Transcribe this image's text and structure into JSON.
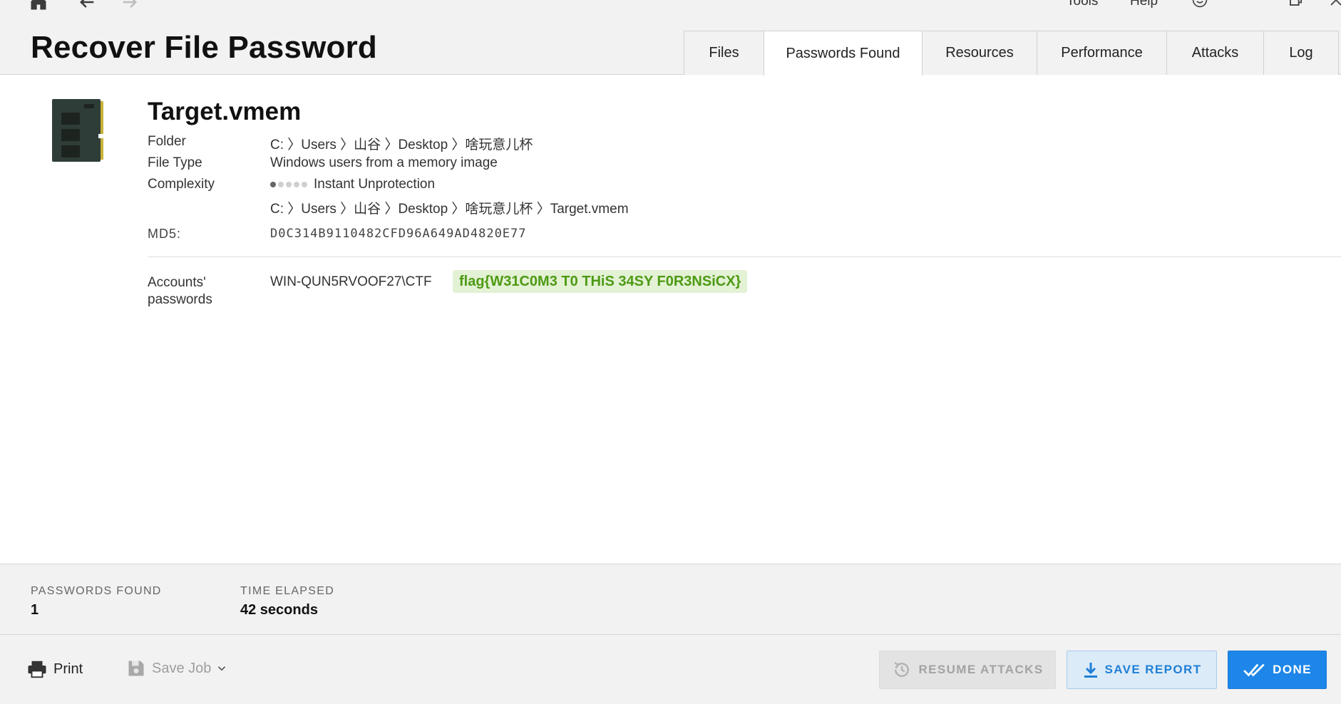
{
  "header": {
    "title": "Recover File Password",
    "menu": {
      "tools": "Tools",
      "help": "Help"
    },
    "tabs": [
      {
        "label": "Files"
      },
      {
        "label": "Passwords Found"
      },
      {
        "label": "Resources"
      },
      {
        "label": "Performance"
      },
      {
        "label": "Attacks"
      },
      {
        "label": "Log"
      }
    ],
    "active_tab": "Passwords Found"
  },
  "file": {
    "name": "Target.vmem",
    "icon": "memory-module-icon",
    "folder_label": "Folder",
    "folder_value": "C: 〉Users 〉山谷 〉Desktop 〉啥玩意儿杯",
    "type_label": "File Type",
    "type_value": "Windows users from a memory image",
    "complexity_label": "Complexity",
    "complexity_value": "Instant Unprotection",
    "complexity_level": 1,
    "complexity_max": 5,
    "full_path": "C: 〉Users 〉山谷 〉Desktop 〉啥玩意儿杯 〉Target.vmem",
    "md5_label": "MD5:",
    "md5_value": "D0C314B9110482CFD96A649AD4820E77",
    "accounts_label": "Accounts' passwords",
    "account_name": "WIN-QUN5RVOOF27\\CTF",
    "account_password": "flag{W31C0M3 T0 THiS 34SY F0R3NSiCX}"
  },
  "stats": {
    "passwords_found_label": "PASSWORDS FOUND",
    "passwords_found_value": "1",
    "time_elapsed_label": "TIME ELAPSED",
    "time_elapsed_value": "42 seconds"
  },
  "footer": {
    "print_label": "Print",
    "save_job_label": "Save Job",
    "resume_label": "RESUME ATTACKS",
    "save_report_label": "SAVE REPORT",
    "done_label": "DONE"
  },
  "colors": {
    "accent": "#1e86e8",
    "password_green": "#4d9a14",
    "password_bg": "#e3f1d4"
  }
}
